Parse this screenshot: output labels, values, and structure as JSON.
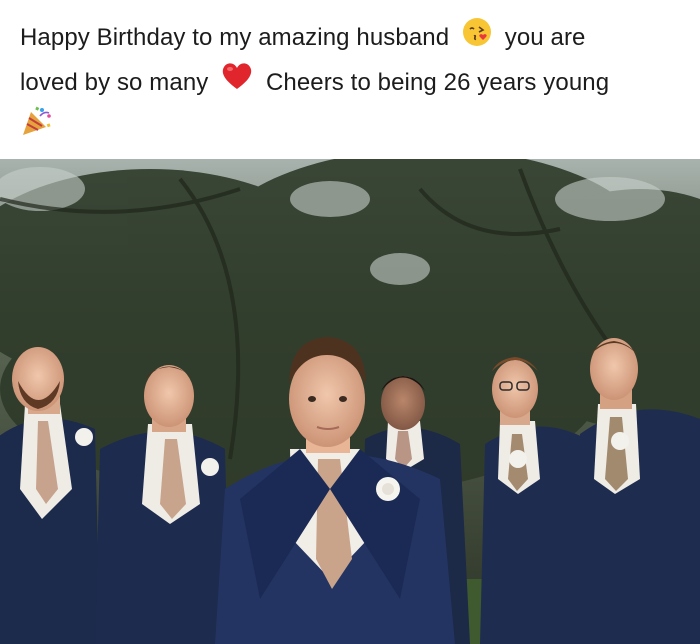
{
  "post": {
    "line1_prefix": "Happy Birthday to my amazing husband",
    "line1_suffix": "you are",
    "line2_prefix": "loved by so many",
    "line2_suffix": "Cheers to being 26 years young",
    "emojis": [
      "kissing-face-emoji",
      "red-heart-emoji",
      "party-popper-emoji"
    ]
  },
  "photo": {
    "subject": "groom-and-groomsmen-photo",
    "colors": {
      "suit": "#1f2d52",
      "tie": "#c9a48b",
      "shirt": "#f1ede7",
      "foliage": "#2f3a2a",
      "sky": "#c9d0cc"
    }
  }
}
